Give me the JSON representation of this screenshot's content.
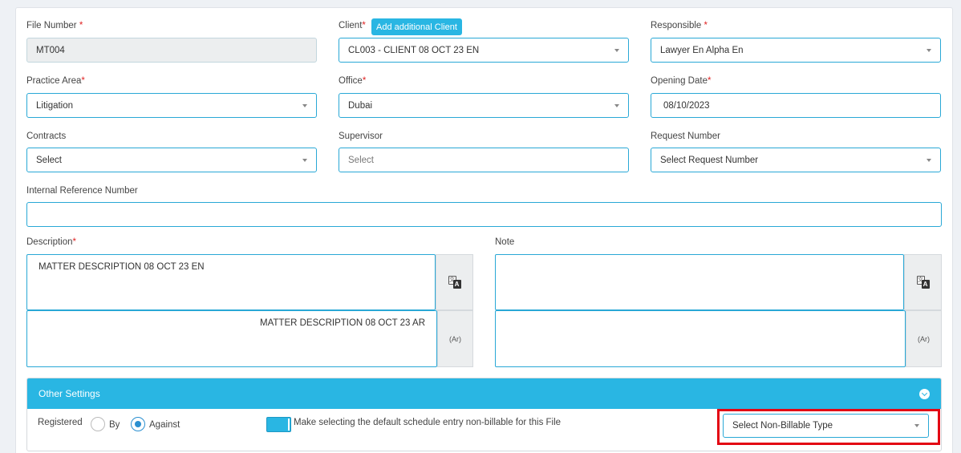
{
  "form": {
    "file_number": {
      "label": "File Number",
      "required": "*",
      "value": "MT004"
    },
    "client": {
      "label": "Client",
      "required": "*",
      "add_button": "Add additional Client",
      "value": "CL003 - CLIENT 08 OCT 23 EN"
    },
    "responsible": {
      "label": "Responsible",
      "required": "*",
      "value": "Lawyer En Alpha En"
    },
    "practice_area": {
      "label": "Practice Area",
      "required": "*",
      "value": "Litigation"
    },
    "office": {
      "label": "Office",
      "required": "*",
      "value": "Dubai"
    },
    "opening_date": {
      "label": "Opening Date",
      "required": "*",
      "value": "08/10/2023"
    },
    "contracts": {
      "label": "Contracts",
      "value": "Select"
    },
    "supervisor": {
      "label": "Supervisor",
      "placeholder": "Select"
    },
    "request_number": {
      "label": "Request Number",
      "value": "Select Request Number"
    },
    "internal_reference": {
      "label": "Internal Reference Number",
      "value": ""
    },
    "description": {
      "label": "Description",
      "required": "*",
      "value_en": "MATTER DESCRIPTION 08 OCT 23 EN",
      "value_ar": "MATTER DESCRIPTION 08 OCT 23 AR",
      "ar_tag": "(Ar)"
    },
    "note": {
      "label": "Note",
      "value_en": "",
      "value_ar": "",
      "ar_tag": "(Ar)"
    }
  },
  "other_settings": {
    "title": "Other Settings",
    "registered_label": "Registered",
    "option_by": "By",
    "option_against": "Against",
    "selected_option": "Against",
    "toggle_on": true,
    "toggle_label": "Make selecting the default schedule entry non-billable for this File",
    "non_billable_placeholder": "Select Non-Billable Type"
  },
  "colors": {
    "accent": "#29b6e3",
    "field_border": "#29a8d6",
    "required": "#e02424",
    "highlight": "#e30613"
  },
  "icons": [
    "caret-down-icon",
    "translate-icon",
    "chevron-circle-down-icon"
  ]
}
